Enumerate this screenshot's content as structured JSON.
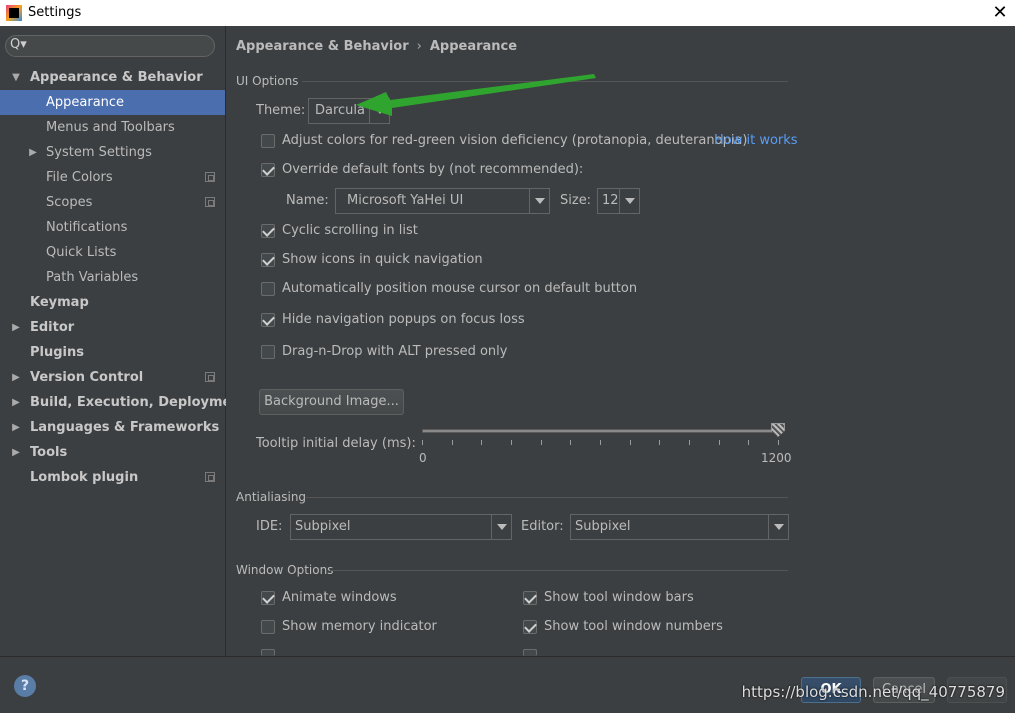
{
  "window": {
    "title": "Settings",
    "close_glyph": "✕"
  },
  "search": {
    "placeholder": "",
    "glyph": "Q▾"
  },
  "sidebar": {
    "items": [
      {
        "label": "Appearance & Behavior"
      },
      {
        "label": "Appearance"
      },
      {
        "label": "Menus and Toolbars"
      },
      {
        "label": "System Settings"
      },
      {
        "label": "File Colors"
      },
      {
        "label": "Scopes"
      },
      {
        "label": "Notifications"
      },
      {
        "label": "Quick Lists"
      },
      {
        "label": "Path Variables"
      },
      {
        "label": "Keymap"
      },
      {
        "label": "Editor"
      },
      {
        "label": "Plugins"
      },
      {
        "label": "Version Control"
      },
      {
        "label": "Build, Execution, Deployment"
      },
      {
        "label": "Languages & Frameworks"
      },
      {
        "label": "Tools"
      },
      {
        "label": "Lombok plugin"
      }
    ],
    "selected": "Appearance"
  },
  "breadcrumb": {
    "parent": "Appearance & Behavior",
    "sep": "›",
    "current": "Appearance"
  },
  "ui_options": {
    "section": "UI Options",
    "theme_label": "Theme:",
    "theme_value": "Darcula",
    "adjust_colors": {
      "label": "Adjust colors for red-green vision deficiency (protanopia, deuteranopia)",
      "checked": false
    },
    "how_it_works": "How it works",
    "override_fonts": {
      "label": "Override default fonts by (not recommended):",
      "checked": true
    },
    "name_label": "Name:",
    "font_name": "Microsoft YaHei UI",
    "size_label": "Size:",
    "font_size": "12",
    "cyclic_scrolling": {
      "label": "Cyclic scrolling in list",
      "checked": true
    },
    "show_icons": {
      "label": "Show icons in quick navigation",
      "checked": true
    },
    "auto_position": {
      "label": "Automatically position mouse cursor on default button",
      "checked": false
    },
    "hide_popups": {
      "label": "Hide navigation popups on focus loss",
      "checked": true
    },
    "drag_drop": {
      "label": "Drag-n-Drop with ALT pressed only",
      "checked": false
    },
    "background_button": "Background Image...",
    "tooltip_label": "Tooltip initial delay (ms):",
    "tooltip_min": "0",
    "tooltip_max": "1200",
    "tooltip_value": 1200
  },
  "antialiasing": {
    "section": "Antialiasing",
    "ide_label": "IDE:",
    "ide_value": "Subpixel",
    "editor_label": "Editor:",
    "editor_value": "Subpixel"
  },
  "window_options": {
    "section": "Window Options",
    "animate_windows": {
      "label": "Animate windows",
      "checked": true
    },
    "memory_indicator": {
      "label": "Show memory indicator",
      "checked": false
    },
    "tool_window_bars": {
      "label": "Show tool window bars",
      "checked": true
    },
    "tool_window_numbers": {
      "label": "Show tool window numbers",
      "checked": true
    }
  },
  "footer": {
    "help_glyph": "?",
    "ok": "OK",
    "cancel": "Cancel"
  },
  "watermark": "https://blog.csdn.net/qq_40775879",
  "colors": {
    "accent": "#4b6eaf",
    "link": "#589df6",
    "background": "#3c3f41",
    "arrow": "#2fa52f"
  }
}
